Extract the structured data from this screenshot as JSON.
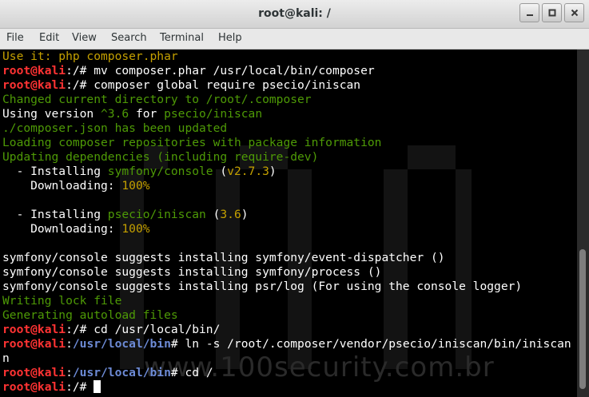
{
  "window": {
    "title": "root@kali: /",
    "buttons": [
      "minimize",
      "maximize",
      "close"
    ]
  },
  "menu": [
    "File",
    "Edit",
    "View",
    "Search",
    "Terminal",
    "Help"
  ],
  "watermark": "www.100security.com.br",
  "lines": [
    [
      {
        "t": "Use it: php composer.phar",
        "c": "yellow"
      }
    ],
    [
      {
        "t": "root@kali",
        "c": "red"
      },
      {
        "t": ":/# mv composer.phar /usr/local/bin/composer",
        "c": "white"
      }
    ],
    [
      {
        "t": "root@kali",
        "c": "red"
      },
      {
        "t": ":/# composer global require psecio/iniscan",
        "c": "white"
      }
    ],
    [
      {
        "t": "Changed current directory to /root/.composer",
        "c": "green"
      }
    ],
    [
      {
        "t": "Using version ",
        "c": "white"
      },
      {
        "t": "^3.6",
        "c": "green"
      },
      {
        "t": " for ",
        "c": "white"
      },
      {
        "t": "psecio/iniscan",
        "c": "green"
      }
    ],
    [
      {
        "t": "./composer.json has been updated",
        "c": "green"
      }
    ],
    [
      {
        "t": "Loading composer repositories with package information",
        "c": "green"
      }
    ],
    [
      {
        "t": "Updating dependencies (including require-dev)",
        "c": "green"
      }
    ],
    [
      {
        "t": "  - Installing ",
        "c": "white"
      },
      {
        "t": "symfony/console",
        "c": "green"
      },
      {
        "t": " (",
        "c": "white"
      },
      {
        "t": "v2.7.3",
        "c": "yellow"
      },
      {
        "t": ")",
        "c": "white"
      }
    ],
    [
      {
        "t": "    Downloading: ",
        "c": "white"
      },
      {
        "t": "100%",
        "c": "yellow"
      }
    ],
    [],
    [
      {
        "t": "  - Installing ",
        "c": "white"
      },
      {
        "t": "psecio/iniscan",
        "c": "green"
      },
      {
        "t": " (",
        "c": "white"
      },
      {
        "t": "3.6",
        "c": "yellow"
      },
      {
        "t": ")",
        "c": "white"
      }
    ],
    [
      {
        "t": "    Downloading: ",
        "c": "white"
      },
      {
        "t": "100%",
        "c": "yellow"
      }
    ],
    [],
    [
      {
        "t": "symfony/console suggests installing symfony/event-dispatcher ()",
        "c": "white"
      }
    ],
    [
      {
        "t": "symfony/console suggests installing symfony/process ()",
        "c": "white"
      }
    ],
    [
      {
        "t": "symfony/console suggests installing psr/log (For using the console logger)",
        "c": "white"
      }
    ],
    [
      {
        "t": "Writing lock file",
        "c": "green"
      }
    ],
    [
      {
        "t": "Generating autoload files",
        "c": "green"
      }
    ],
    [
      {
        "t": "root@kali",
        "c": "red"
      },
      {
        "t": ":/# cd /usr/local/bin/",
        "c": "white"
      }
    ],
    [
      {
        "t": "root@kali",
        "c": "red"
      },
      {
        "t": ":",
        "c": "white"
      },
      {
        "t": "/usr/local/bin",
        "c": "blue"
      },
      {
        "t": "# ln -s /root/.composer/vendor/psecio/iniscan/bin/iniscan",
        "c": "white"
      }
    ],
    [
      {
        "t": "n",
        "c": "white"
      }
    ],
    [
      {
        "t": "root@kali",
        "c": "red"
      },
      {
        "t": ":",
        "c": "white"
      },
      {
        "t": "/usr/local/bin",
        "c": "blue"
      },
      {
        "t": "# cd /",
        "c": "white"
      }
    ],
    [
      {
        "t": "root@kali",
        "c": "red"
      },
      {
        "t": ":/# ",
        "c": "white"
      }
    ]
  ]
}
